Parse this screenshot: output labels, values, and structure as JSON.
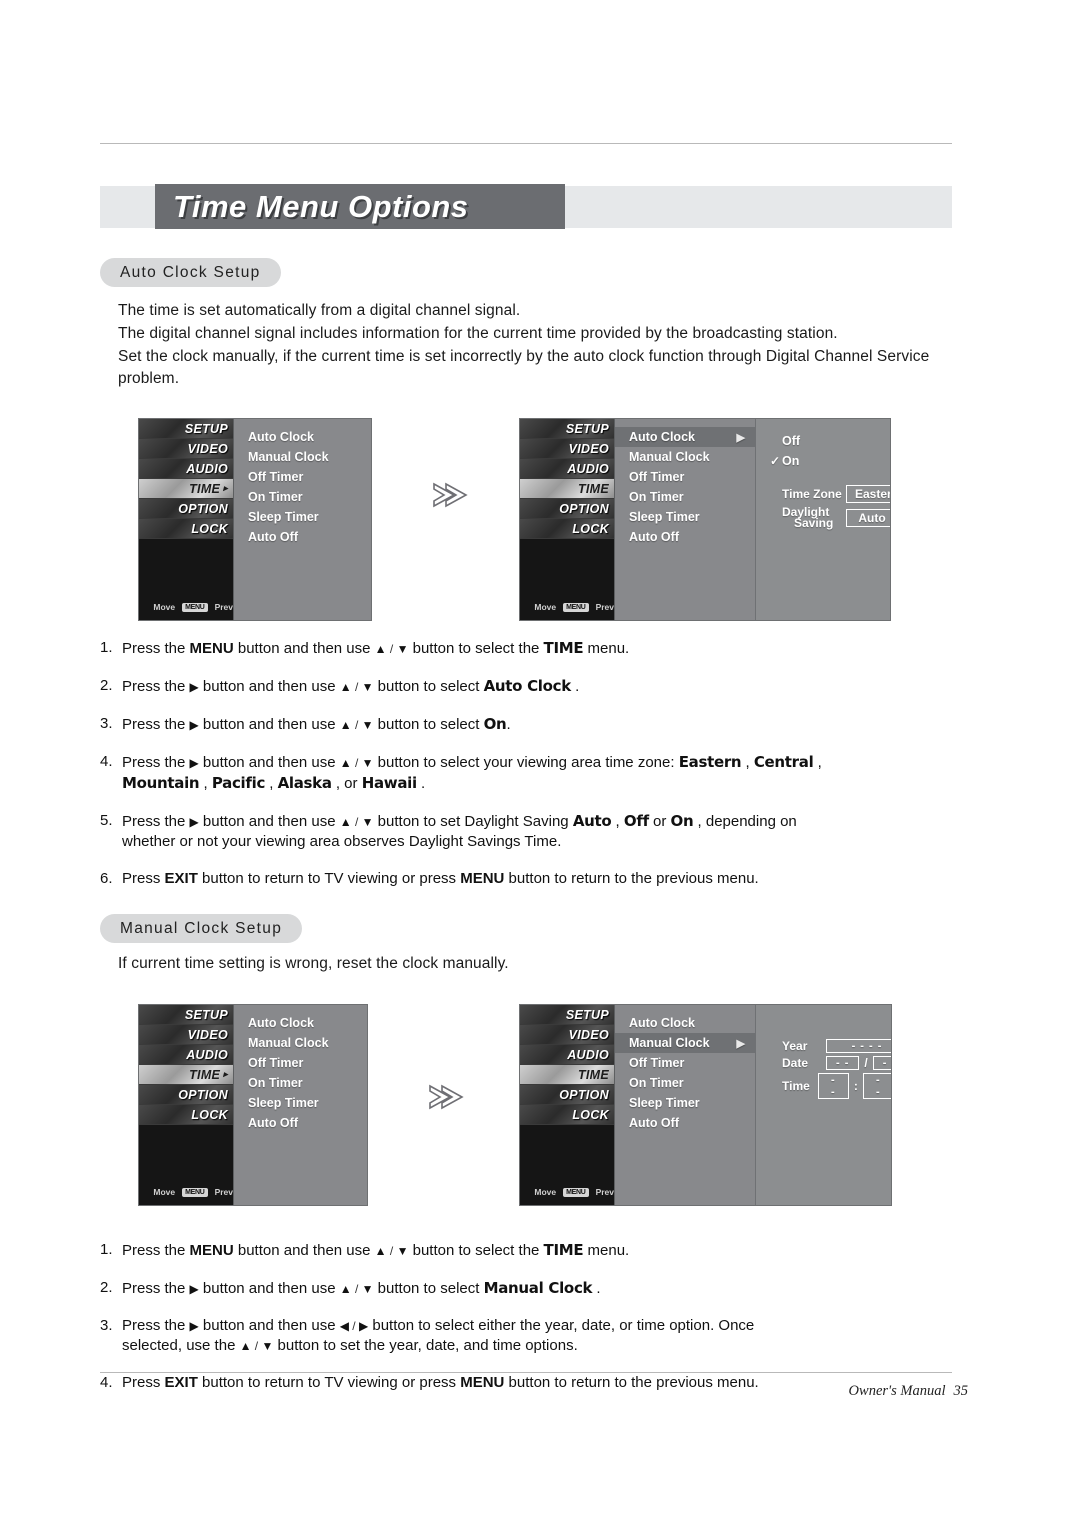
{
  "header": {
    "title": "Time Menu Options"
  },
  "sections": [
    {
      "pill": "Auto Clock Setup",
      "paragraph": "The time is set automatically from a digital channel signal.\nThe digital channel signal includes information for the current time provided by the broadcasting station.\nSet the clock manually, if the current time is set incorrectly by the auto clock function through Digital Channel Service problem."
    },
    {
      "pill": "Manual Clock Setup",
      "paragraph": "If current time setting is wrong, reset the clock manually."
    }
  ],
  "tv_menu": {
    "sidebar_tabs": [
      "SETUP",
      "VIDEO",
      "AUDIO",
      "TIME",
      "OPTION",
      "LOCK"
    ],
    "menu_items": [
      "Auto Clock",
      "Manual Clock",
      "Off Timer",
      "On Timer",
      "Sleep Timer",
      "Auto Off"
    ],
    "footer_move": "Move",
    "footer_menu_key": "MENU",
    "footer_prev": "Prev",
    "arrow_glyph": "▶",
    "check_glyph": "✓"
  },
  "auto_clock_submenu": {
    "options": [
      "Off",
      "On"
    ],
    "selected_option": "On",
    "time_zone_label": "Time Zone",
    "time_zone_value": "Eastern",
    "daylight_label_line1": "Daylight",
    "daylight_label_line2": "Saving",
    "daylight_value": "Auto"
  },
  "manual_clock_submenu": {
    "year_label": "Year",
    "year_value": "- - - -",
    "date_label": "Date",
    "date_month": "- -",
    "date_separator": "/",
    "date_day": "- -",
    "time_label": "Time",
    "time_hour": "- -",
    "time_separator": ":",
    "time_minute": "- -",
    "time_meridiem": "- -"
  },
  "auto_steps": [
    {
      "num": "1.",
      "parts": [
        {
          "t": "Press the ",
          "s": "n"
        },
        {
          "t": "MENU",
          "s": "b"
        },
        {
          "t": " button and then use ",
          "s": "n"
        },
        {
          "t": "▲",
          "s": "tri"
        },
        {
          "t": " / ",
          "s": "sl"
        },
        {
          "t": "▼",
          "s": "tri"
        },
        {
          "t": " button to select the ",
          "s": "n"
        },
        {
          "t": "TIME",
          "s": "blk"
        },
        {
          "t": " menu.",
          "s": "n"
        }
      ]
    },
    {
      "num": "2.",
      "parts": [
        {
          "t": "Press the ",
          "s": "n"
        },
        {
          "t": "▶",
          "s": "tri"
        },
        {
          "t": " button and then use ",
          "s": "n"
        },
        {
          "t": "▲",
          "s": "tri"
        },
        {
          "t": " / ",
          "s": "sl"
        },
        {
          "t": "▼",
          "s": "tri"
        },
        {
          "t": " button to select ",
          "s": "n"
        },
        {
          "t": "Auto Clock",
          "s": "blk"
        },
        {
          "t": " .",
          "s": "n"
        }
      ]
    },
    {
      "num": "3.",
      "parts": [
        {
          "t": "Press the ",
          "s": "n"
        },
        {
          "t": "▶",
          "s": "tri"
        },
        {
          "t": " button and then use ",
          "s": "n"
        },
        {
          "t": "▲",
          "s": "tri"
        },
        {
          "t": " / ",
          "s": "sl"
        },
        {
          "t": "▼",
          "s": "tri"
        },
        {
          "t": " button to select ",
          "s": "n"
        },
        {
          "t": "On",
          "s": "blk"
        },
        {
          "t": ".",
          "s": "n"
        }
      ]
    },
    {
      "num": "4.",
      "parts": [
        {
          "t": "Press the ",
          "s": "n"
        },
        {
          "t": "▶",
          "s": "tri"
        },
        {
          "t": " button and then use ",
          "s": "n"
        },
        {
          "t": "▲",
          "s": "tri"
        },
        {
          "t": " / ",
          "s": "sl"
        },
        {
          "t": "▼",
          "s": "tri"
        },
        {
          "t": " button to select your viewing area time zone: ",
          "s": "n"
        },
        {
          "t": "Eastern",
          "s": "blk"
        },
        {
          "t": " , ",
          "s": "n"
        },
        {
          "t": "Central",
          "s": "blk"
        },
        {
          "t": " ,",
          "s": "n"
        },
        {
          "t": "\n",
          "s": "br"
        },
        {
          "t": "Mountain",
          "s": "blk"
        },
        {
          "t": " , ",
          "s": "n"
        },
        {
          "t": "Pacific",
          "s": "blk"
        },
        {
          "t": " , ",
          "s": "n"
        },
        {
          "t": "Alaska",
          "s": "blk"
        },
        {
          "t": " ,  or  ",
          "s": "n"
        },
        {
          "t": "Hawaii",
          "s": "blk"
        },
        {
          "t": " .",
          "s": "n"
        }
      ]
    },
    {
      "num": "5.",
      "parts": [
        {
          "t": "Press the ",
          "s": "n"
        },
        {
          "t": "▶",
          "s": "tri"
        },
        {
          "t": " button and then use ",
          "s": "n"
        },
        {
          "t": "▲",
          "s": "tri"
        },
        {
          "t": " / ",
          "s": "sl"
        },
        {
          "t": "▼",
          "s": "tri"
        },
        {
          "t": " button to set Daylight Saving ",
          "s": "n"
        },
        {
          "t": "Auto",
          "s": "blk"
        },
        {
          "t": " , ",
          "s": "n"
        },
        {
          "t": "Off",
          "s": "blk"
        },
        {
          "t": " or  ",
          "s": "n"
        },
        {
          "t": "On",
          "s": "blk"
        },
        {
          "t": " , depending on",
          "s": "n"
        },
        {
          "t": "\n",
          "s": "br"
        },
        {
          "t": "whether or not your viewing area observes Daylight Savings Time.",
          "s": "n"
        }
      ]
    },
    {
      "num": "6.",
      "parts": [
        {
          "t": "Press  ",
          "s": "n"
        },
        {
          "t": "EXIT",
          "s": "b"
        },
        {
          "t": " button to return to TV viewing or press ",
          "s": "n"
        },
        {
          "t": "MENU",
          "s": "b"
        },
        {
          "t": " button to return to the previous menu.",
          "s": "n"
        }
      ]
    }
  ],
  "manual_steps": [
    {
      "num": "1.",
      "parts": [
        {
          "t": "Press the ",
          "s": "n"
        },
        {
          "t": "MENU",
          "s": "b"
        },
        {
          "t": " button and then use ",
          "s": "n"
        },
        {
          "t": "▲",
          "s": "tri"
        },
        {
          "t": " / ",
          "s": "sl"
        },
        {
          "t": "▼",
          "s": "tri"
        },
        {
          "t": "  button to select the ",
          "s": "n"
        },
        {
          "t": "TIME",
          "s": "blk"
        },
        {
          "t": " menu.",
          "s": "n"
        }
      ]
    },
    {
      "num": "2.",
      "parts": [
        {
          "t": "Press the ",
          "s": "n"
        },
        {
          "t": "▶",
          "s": "tri"
        },
        {
          "t": " button and then use ",
          "s": "n"
        },
        {
          "t": "▲",
          "s": "tri"
        },
        {
          "t": " / ",
          "s": "sl"
        },
        {
          "t": "▼",
          "s": "tri"
        },
        {
          "t": " button to select ",
          "s": "n"
        },
        {
          "t": "Manual Clock",
          "s": "blk"
        },
        {
          "t": " .",
          "s": "n"
        }
      ]
    },
    {
      "num": "3.",
      "parts": [
        {
          "t": "Press the ",
          "s": "n"
        },
        {
          "t": "▶",
          "s": "tri"
        },
        {
          "t": " button and then use ",
          "s": "n"
        },
        {
          "t": "◀",
          "s": "tri"
        },
        {
          "t": " / ",
          "s": "sl"
        },
        {
          "t": "▶",
          "s": "tri"
        },
        {
          "t": " button to select either the year, date, or time option. Once",
          "s": "n"
        },
        {
          "t": "\n",
          "s": "br"
        },
        {
          "t": "selected, use the ",
          "s": "n"
        },
        {
          "t": "▲",
          "s": "tri"
        },
        {
          "t": " / ",
          "s": "sl"
        },
        {
          "t": "▼",
          "s": "tri"
        },
        {
          "t": " button to set the year, date, and time options.",
          "s": "n"
        }
      ]
    },
    {
      "num": "4.",
      "parts": [
        {
          "t": "Press  ",
          "s": "n"
        },
        {
          "t": "EXIT",
          "s": "b"
        },
        {
          "t": " button to return to TV viewing or press ",
          "s": "n"
        },
        {
          "t": "MENU",
          "s": "b"
        },
        {
          "t": " button to return to the previous menu.",
          "s": "n"
        }
      ]
    }
  ],
  "footer": {
    "manual_label": "Owner's Manual",
    "page_number": "35"
  },
  "colors": {
    "title_box": "#6b6d71",
    "title_band": "#e6e8ea",
    "pill": "#d8d9da",
    "menu_panel": "#8c8e90",
    "menu_list": "#88898c",
    "menu_selected": "#6f7174",
    "sidebar": "#1a1a1a"
  }
}
